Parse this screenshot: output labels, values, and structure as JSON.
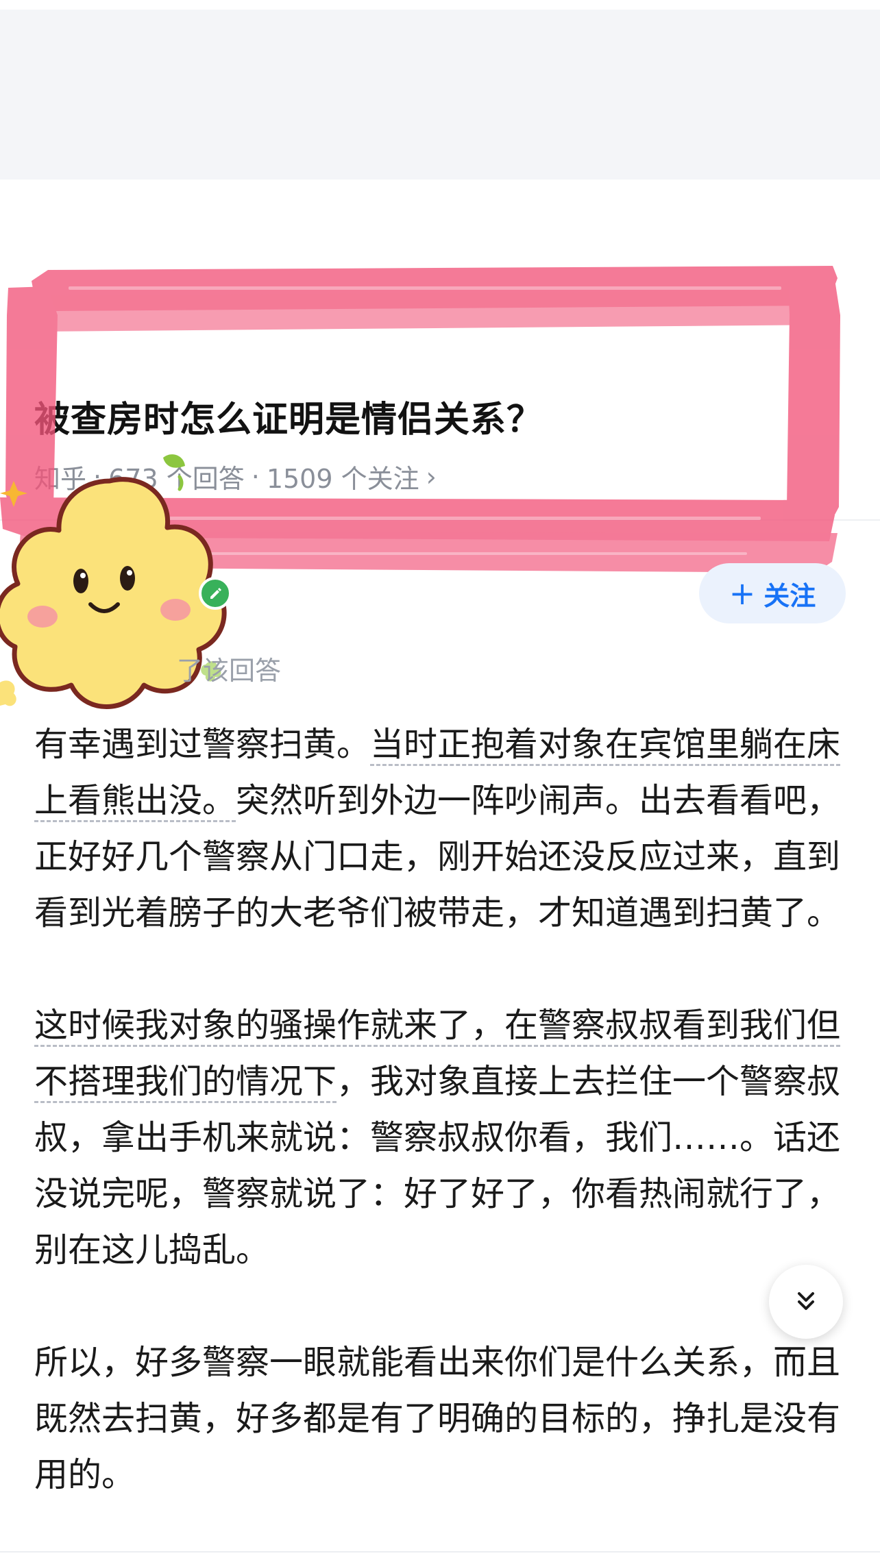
{
  "question": {
    "title": "被查房时怎么证明是情侣关系？",
    "source": "知乎",
    "separator_1": "·",
    "answers_count": "673 个回答",
    "separator_2": "·",
    "followers_count": "1509 个关注",
    "chevron": "›"
  },
  "author": {
    "badge_icon": "pencil-badge-icon",
    "follow_plus": "+",
    "follow_label": "关注",
    "endorse_text": "了该回答"
  },
  "answer": {
    "p1_plain": "有幸遇到过警察扫黄。",
    "p1_link": "当时正抱着对象在宾馆里躺在床上看熊出没。",
    "p1_rest": "突然听到外边一阵吵闹声。出去看看吧，正好好几个警察从门口走，刚开始还没反应过来，直到看到光着膀子的大老爷们被带走，才知道遇到扫黄了。",
    "p2_link": "这时候我对象的骚操作就来了，在警察叔叔看到我们但不搭理我们的情况下",
    "p2_rest": "，我对象直接上去拦住一个警察叔叔，拿出手机来就说：警察叔叔你看，我们……。话还没说完呢，警察就说了：好了好了，你看热闹就行了，别在这儿捣乱。",
    "p3": "所以，好多警察一眼就能看出来你们是什么关系，而且既然去扫黄，好多都是有了明确的目标的，挣扎是没有用的。"
  },
  "colors": {
    "accent_blue": "#1772f6",
    "highlight_pink": "#f2557a",
    "sticker_yellow": "#fbe27a"
  }
}
